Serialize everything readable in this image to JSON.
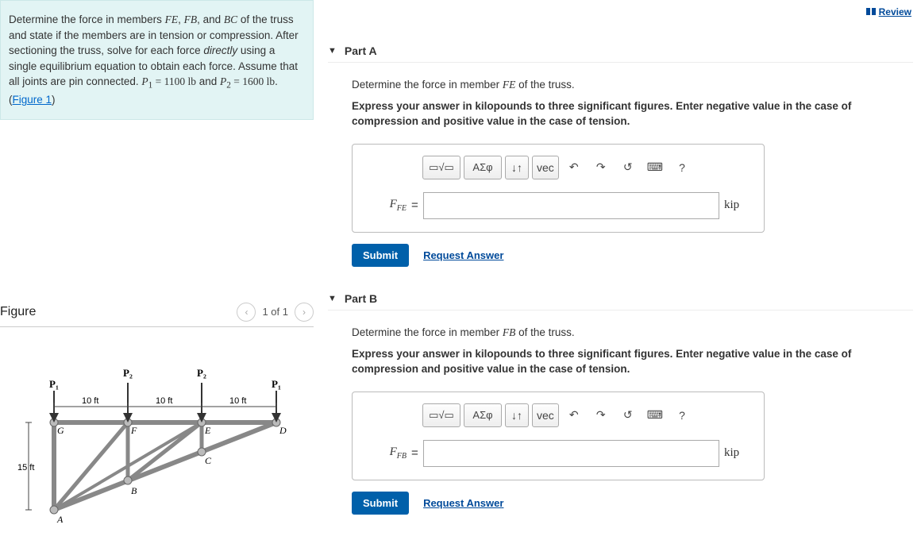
{
  "problem": {
    "text_pre": "Determine the force in members ",
    "m1": "FE",
    "m2": "FB",
    "m3": "BC",
    "text_mid": " of the truss and state if the members are in tension or compression. After sectioning the truss, solve for each force ",
    "text_directly": "directly",
    "text_post": " using a single equilibrium equation to obtain each force. Assume that all joints are pin connected. ",
    "p1_var": "P",
    "p1_sub": "1",
    "p1_eq": " = 1100 ",
    "p1_unit": "lb",
    "and": " and ",
    "p2_var": "P",
    "p2_sub": "2",
    "p2_eq": " = 1600 ",
    "p2_unit": "lb",
    "period": ". (",
    "figure_link": "Figure 1",
    "close": ")"
  },
  "figure": {
    "title": "Figure",
    "pager": "1 of 1",
    "labels": {
      "P1": "P₁",
      "P2": "P₂",
      "ten": "10 ft",
      "fifteen": "15 ft",
      "A": "A",
      "B": "B",
      "C": "C",
      "D": "D",
      "E": "E",
      "F": "F",
      "G": "G"
    }
  },
  "review": "Review",
  "parts": [
    {
      "label": "Part A",
      "question_pre": "Determine the force in member ",
      "member": "FE",
      "question_post": " of the truss.",
      "hint": "Express your answer in kilopounds to three significant figures. Enter negative value in the case of compression and positive value in the case of tension.",
      "var": "F",
      "sub": "FE",
      "unit": "kip",
      "submit": "Submit",
      "request": "Request Answer"
    },
    {
      "label": "Part B",
      "question_pre": "Determine the force in member ",
      "member": "FB",
      "question_post": " of the truss.",
      "hint": "Express your answer in kilopounds to three significant figures. Enter negative value in the case of compression and positive value in the case of tension.",
      "var": "F",
      "sub": "FB",
      "unit": "kip",
      "submit": "Submit",
      "request": "Request Answer"
    }
  ],
  "toolbar": {
    "tpl": "▭√▭",
    "greek": "ΑΣφ",
    "subsup": "↓↑",
    "vec": "vec",
    "undo": "↶",
    "redo": "↷",
    "reset": "↺",
    "keyboard": "⌨",
    "help": "?"
  }
}
